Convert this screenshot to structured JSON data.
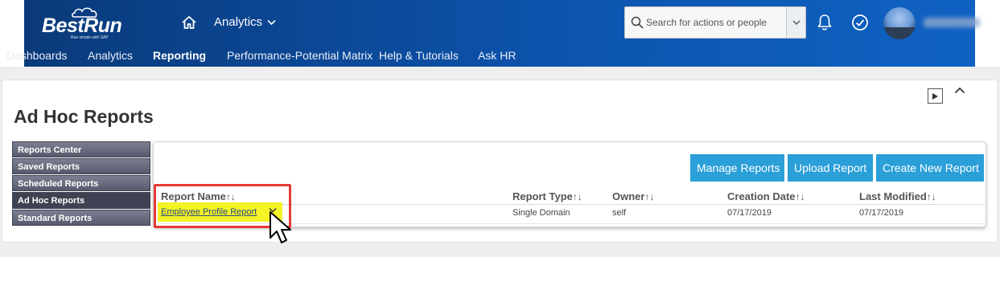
{
  "header": {
    "logo_text": "BestRun",
    "logo_tagline": "Run simple with SAP",
    "module_label": "Analytics",
    "search_placeholder": "Search for actions or people"
  },
  "topnav": {
    "items": [
      {
        "label": "Dashboards",
        "active": false
      },
      {
        "label": "Analytics",
        "active": false
      },
      {
        "label": "Reporting",
        "active": true
      },
      {
        "label": "Performance-Potential Matrix",
        "active": false
      },
      {
        "label": "Help & Tutorials",
        "active": false
      },
      {
        "label": "Ask HR",
        "active": false
      }
    ]
  },
  "page": {
    "title": "Ad Hoc Reports"
  },
  "sidebar": {
    "items": [
      {
        "label": "Reports Center"
      },
      {
        "label": "Saved Reports"
      },
      {
        "label": "Scheduled Reports"
      },
      {
        "label": "Ad Hoc Reports",
        "active": true
      },
      {
        "label": "Standard Reports"
      }
    ]
  },
  "actions": {
    "manage": "Manage Reports",
    "upload": "Upload Report",
    "create": "Create New Report"
  },
  "table": {
    "columns": [
      "Report Name",
      "Report Type",
      "Owner",
      "Creation Date",
      "Last Modified"
    ],
    "sort_glyph": "↑↓",
    "rows": [
      {
        "name": "Employee Profile Report",
        "type": "Single Domain",
        "owner": "self",
        "created": "07/17/2019",
        "modified": "07/17/2019"
      }
    ]
  },
  "colors": {
    "header_blue": "#0d55b0",
    "button_blue": "#2a9fd8",
    "highlight_yellow": "#f3f326",
    "annotation_red": "#e53935",
    "sidebar_gray": "#565a6d"
  },
  "icons": [
    "home-icon",
    "chevron-down-icon",
    "search-icon",
    "bell-icon",
    "check-circle-icon",
    "avatar",
    "play-icon",
    "chevron-up-icon",
    "sort-icon",
    "mouse-cursor-icon"
  ]
}
